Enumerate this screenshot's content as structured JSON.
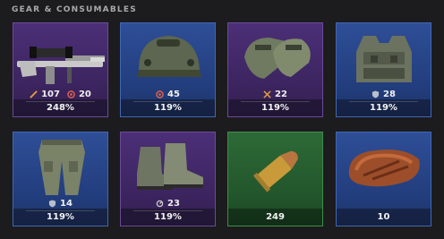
{
  "section": {
    "title": "GEAR & CONSUMABLES"
  },
  "colors": {
    "purple": "#3b245e",
    "blue": "#223d7c",
    "green": "#22552b"
  },
  "items": [
    {
      "icon": "sniper-rifle-icon",
      "rarity": "purple",
      "stat1": "107",
      "stat1_icon": "damage-icon",
      "stat2": "20",
      "stat2_icon": "accuracy-icon",
      "value": "248%"
    },
    {
      "icon": "helmet-icon",
      "rarity": "blue",
      "stat1": "45",
      "stat1_icon": "target-icon",
      "value": "119%"
    },
    {
      "icon": "gloves-icon",
      "rarity": "purple",
      "stat1": "22",
      "stat1_icon": "crosshair-icon",
      "value": "119%"
    },
    {
      "icon": "vest-icon",
      "rarity": "blue",
      "stat1": "28",
      "stat1_icon": "shield-icon",
      "value": "119%"
    },
    {
      "icon": "pants-icon",
      "rarity": "blue",
      "stat1": "14",
      "stat1_icon": "shield-icon",
      "value": "119%"
    },
    {
      "icon": "boots-icon",
      "rarity": "purple",
      "stat1": "23",
      "stat1_icon": "speed-icon",
      "value": "119%"
    },
    {
      "icon": "ammo-icon",
      "rarity": "green",
      "value": "249"
    },
    {
      "icon": "steak-icon",
      "rarity": "blue",
      "value": "10"
    }
  ]
}
